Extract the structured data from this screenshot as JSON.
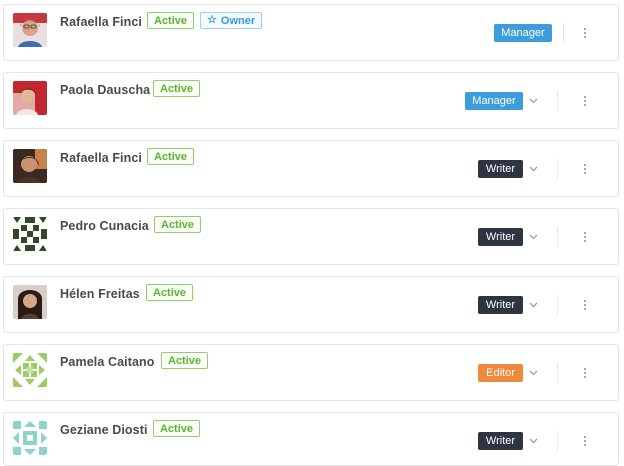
{
  "members": [
    {
      "name": "Rafaella Finci",
      "status": "Active",
      "owner_label": "Owner",
      "role": "Manager",
      "role_color": "#3d9ddb",
      "avatar": "rafaella-photo-icon",
      "has_dropdown": false
    },
    {
      "name": "Paola Dauscha",
      "status": "Active",
      "role": "Manager",
      "role_color": "#3d9ddb",
      "avatar": "paola-photo-icon",
      "has_dropdown": true
    },
    {
      "name": "Rafaella Finci",
      "status": "Active",
      "role": "Writer",
      "role_color": "#2f3441",
      "avatar": "rafaella-photo-icon",
      "has_dropdown": true
    },
    {
      "name": "Pedro Cunacia",
      "status": "Active",
      "role": "Writer",
      "role_color": "#2f3441",
      "avatar": "identicon-dark-green-icon",
      "has_dropdown": true
    },
    {
      "name": "Hélen Freitas",
      "status": "Active",
      "role": "Writer",
      "role_color": "#2f3441",
      "avatar": "helen-photo-icon",
      "has_dropdown": true
    },
    {
      "name": "Pamela Caitano",
      "status": "Active",
      "role": "Editor",
      "role_color": "#ef8a3c",
      "avatar": "identicon-light-green-icon",
      "has_dropdown": true
    },
    {
      "name": "Geziane Diosti",
      "status": "Active",
      "role": "Writer",
      "role_color": "#2f3441",
      "avatar": "identicon-teal-icon",
      "has_dropdown": true
    }
  ],
  "colors": {
    "active_border": "#8fd06c",
    "active_text": "#59b52f",
    "owner_text": "#3a9ad9"
  },
  "icons": {
    "owner_badge": "star-outline-icon",
    "role_dropdown": "chevron-down-icon",
    "row_menu": "more-vertical-icon"
  }
}
